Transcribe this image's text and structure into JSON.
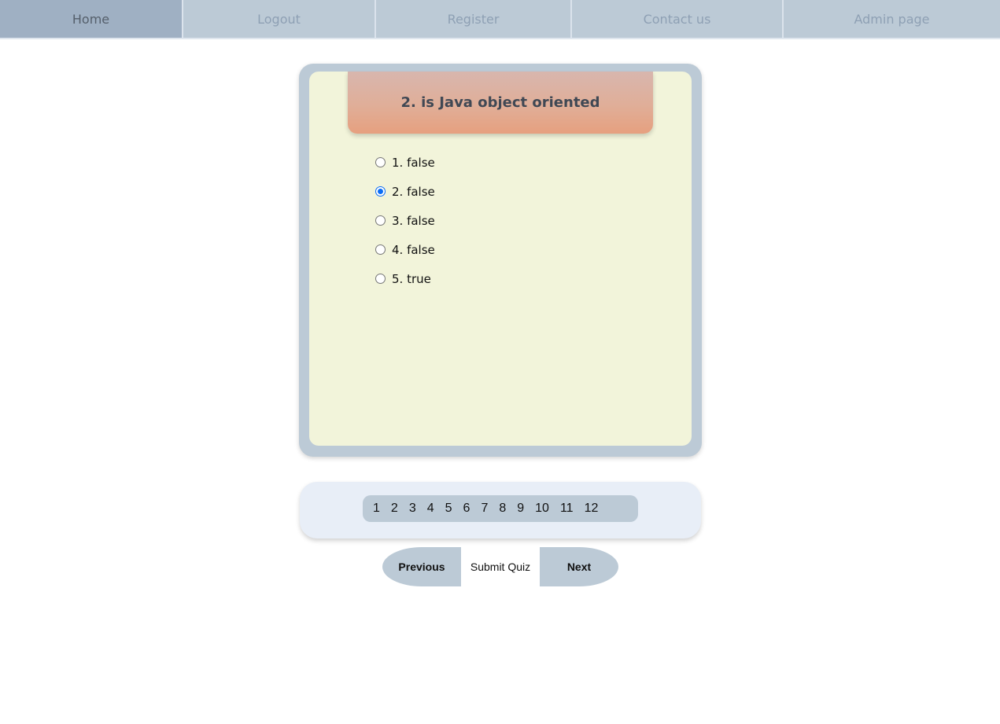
{
  "nav": {
    "items": [
      {
        "label": "Home",
        "active": true
      },
      {
        "label": "Logout",
        "active": false
      },
      {
        "label": "Register",
        "active": false
      },
      {
        "label": "Contact us",
        "active": false
      },
      {
        "label": "Admin page",
        "active": false
      }
    ]
  },
  "quiz": {
    "question": "2. is Java object oriented",
    "options": [
      {
        "label": "1. false",
        "checked": false
      },
      {
        "label": "2. false",
        "checked": true
      },
      {
        "label": "3. false",
        "checked": false
      },
      {
        "label": "4. false",
        "checked": false
      },
      {
        "label": "5. true",
        "checked": false
      }
    ]
  },
  "pagination": {
    "pages": [
      "1",
      "2",
      "3",
      "4",
      "5",
      "6",
      "7",
      "8",
      "9",
      "10",
      "11",
      "12"
    ]
  },
  "buttons": {
    "previous": "Previous",
    "submit": "Submit Quiz",
    "next": "Next"
  },
  "colors": {
    "nav_bg": "#bccad6",
    "nav_active_bg": "#9fb0c3",
    "card_frame": "#bccad6",
    "card_inner": "#f2f4da",
    "banner_top": "#d8b6ae",
    "banner_bottom": "#e6a07f",
    "pager_panel": "#e8eef7",
    "radio_checked": "#0a6cf5"
  }
}
